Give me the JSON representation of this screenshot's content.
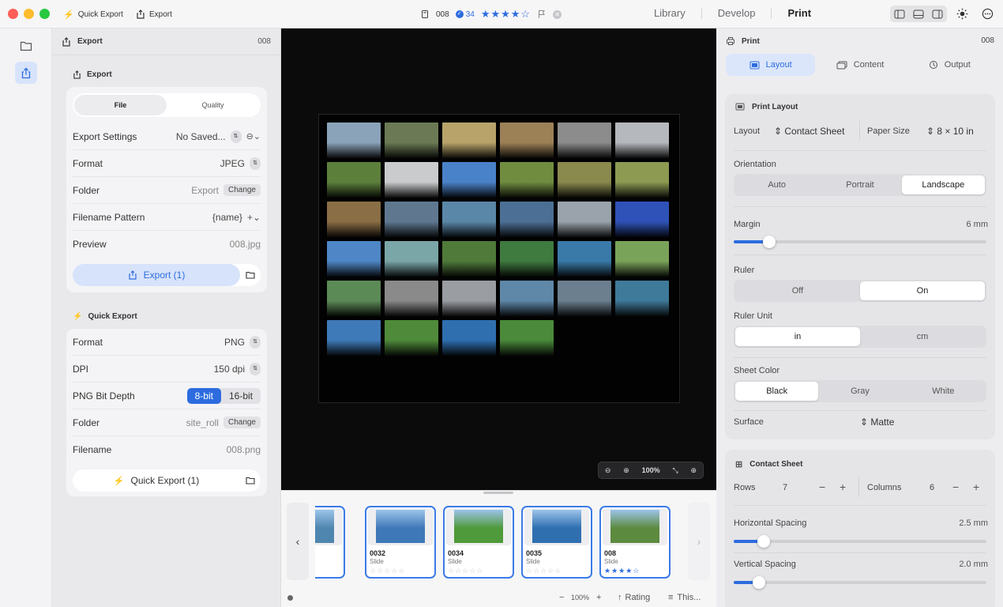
{
  "topbar": {
    "quick_export": "Quick Export",
    "export": "Export",
    "photo_id": "008",
    "selected_count": "34",
    "stars": "★★★★☆",
    "modules": [
      "Library",
      "Develop",
      "Print"
    ]
  },
  "left_panel": {
    "header_title": "Export",
    "header_id": "008",
    "export_section": {
      "title": "Export",
      "tabs": [
        "File",
        "Quality"
      ],
      "rows": [
        {
          "label": "Export Settings",
          "value": "No Saved..."
        },
        {
          "label": "Format",
          "value": "JPEG"
        },
        {
          "label": "Folder",
          "value": "Export",
          "action": "Change"
        },
        {
          "label": "Filename Pattern",
          "value": "{name}"
        },
        {
          "label": "Preview",
          "value": "008.jpg"
        }
      ],
      "button": "Export (1)"
    },
    "quick_export_section": {
      "title": "Quick Export",
      "rows": [
        {
          "label": "Format",
          "value": "PNG"
        },
        {
          "label": "DPI",
          "value": "150 dpi"
        },
        {
          "label": "PNG Bit Depth",
          "options": [
            "8-bit",
            "16-bit"
          ]
        },
        {
          "label": "Folder",
          "value": "site_roll",
          "action": "Change"
        },
        {
          "label": "Filename",
          "value": "008.png"
        }
      ],
      "button": "Quick Export (1)"
    }
  },
  "canvas": {
    "zoom": "100%",
    "thumb_colors": [
      [
        "#8aa3b8",
        "#6b7a55",
        "#b8a46a",
        "#9c8157",
        "#8c8c8c",
        "#b5b8bd"
      ],
      [
        "#5d7f3c",
        "#c9cbcc",
        "#4a82c9",
        "#6f8c3f",
        "#8a8a4f",
        "#8c9a52"
      ],
      [
        "#8a6e45",
        "#5f7890",
        "#5a87a8",
        "#4c6f95",
        "#9aa3ab",
        "#2f52b8"
      ],
      [
        "#4f86c5",
        "#7aa6a8",
        "#4f7a3a",
        "#3f7a3f",
        "#3a7aa8",
        "#7aa35a"
      ],
      [
        "#5c8a57",
        "#8a8a8a",
        "#9a9ea3",
        "#5f87a8",
        "#6b7f8f",
        "#3f7a9a"
      ],
      [
        "#3f7ab8",
        "#4f8a3a",
        "#2f6fb0",
        "#4a8a3a"
      ]
    ]
  },
  "filmstrip": {
    "cards": [
      {
        "id": "",
        "type": "",
        "stars": "☆☆",
        "color": "#4f86b0",
        "rated": false
      },
      {
        "id": "0032",
        "type": "Slide",
        "stars": "☆☆☆☆☆",
        "color": "#3f78b8",
        "rated": false
      },
      {
        "id": "0034",
        "type": "Slide",
        "stars": "☆☆☆☆☆",
        "color": "#4f9a3a",
        "rated": false
      },
      {
        "id": "0035",
        "type": "Slide",
        "stars": "☆☆☆☆☆",
        "color": "#2f6fb0",
        "rated": false
      },
      {
        "id": "008",
        "type": "Slide",
        "stars": "★★★★☆",
        "color": "#5c8a3f",
        "rated": true
      }
    ],
    "zoom": "100%",
    "sort_label": "Rating",
    "filter_label": "This..."
  },
  "right_panel": {
    "header_title": "Print",
    "header_id": "008",
    "tabs": [
      "Layout",
      "Content",
      "Output"
    ],
    "print_layout": {
      "title": "Print Layout",
      "layout_label": "Layout",
      "layout_value": "Contact Sheet",
      "paper_label": "Paper Size",
      "paper_value": "8 × 10 in",
      "orientation_label": "Orientation",
      "orientation_options": [
        "Auto",
        "Portrait",
        "Landscape"
      ],
      "margin_label": "Margin",
      "margin_value": "6 mm",
      "margin_level": 0.14,
      "ruler_label": "Ruler",
      "ruler_options": [
        "Off",
        "On"
      ],
      "ruler_unit_label": "Ruler Unit",
      "ruler_unit_options": [
        "in",
        "cm"
      ],
      "sheet_color_label": "Sheet Color",
      "sheet_color_options": [
        "Black",
        "Gray",
        "White"
      ],
      "surface_label": "Surface",
      "surface_value": "Matte"
    },
    "contact_sheet": {
      "title": "Contact Sheet",
      "rows_label": "Rows",
      "rows_value": "7",
      "columns_label": "Columns",
      "columns_value": "6",
      "h_spacing_label": "Horizontal Spacing",
      "h_spacing_value": "2.5 mm",
      "h_spacing_level": 0.12,
      "v_spacing_label": "Vertical Spacing",
      "v_spacing_value": "2.0 mm",
      "v_spacing_level": 0.1
    }
  }
}
